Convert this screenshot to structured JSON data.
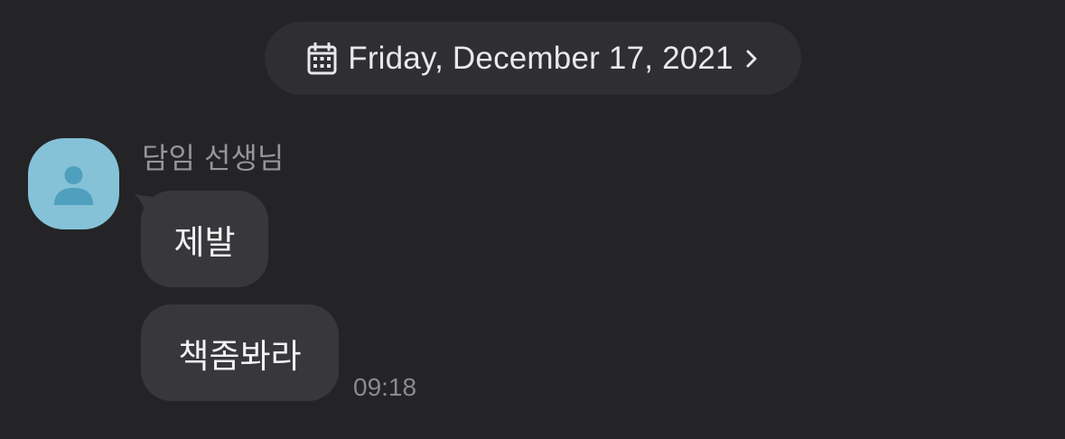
{
  "date_header": {
    "label": "Friday, December 17, 2021",
    "icon": "calendar-icon",
    "trailing_icon": "chevron-right-icon"
  },
  "conversation": {
    "sender_name": "담임 선생님",
    "avatar_icon": "person-icon",
    "avatar_color": "#85c2d8",
    "messages": [
      {
        "text": "제발"
      },
      {
        "text": "책좀봐라",
        "time": "09:18"
      }
    ]
  },
  "colors": {
    "background": "#242427",
    "bubble": "#38383b",
    "date_pill": "#2f2f33"
  }
}
